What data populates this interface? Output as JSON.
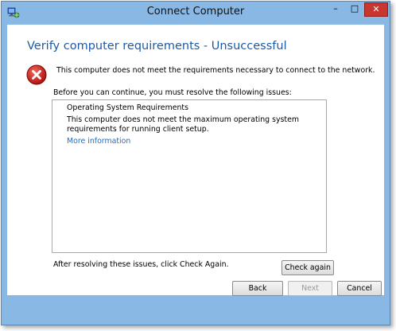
{
  "window": {
    "title": "Connect Computer",
    "controls": {
      "minimize": "–",
      "maximize": "□",
      "close": "✕"
    }
  },
  "page": {
    "heading": "Verify computer requirements - Unsuccessful",
    "error_message": "This computer does not meet the requirements necessary to connect to the network.",
    "before_message": "Before you can continue, you must resolve the following issues:",
    "issues": [
      {
        "title": "Operating System Requirements",
        "description": "This computer does not meet the maximum operating system requirements for running client setup.",
        "link": "More information"
      }
    ],
    "after_message": "After resolving these issues, click Check Again.",
    "check_again_label": "Check again"
  },
  "footer": {
    "back_label": "Back",
    "next_label": "Next",
    "cancel_label": "Cancel"
  },
  "colors": {
    "frame": "#8ab8e4",
    "heading": "#1c5aa6",
    "link": "#1a6fc8",
    "close_button": "#c7372f",
    "error_icon": "#d0201c"
  },
  "icons": {
    "app": "network-computer-icon",
    "status": "error-x-icon"
  }
}
